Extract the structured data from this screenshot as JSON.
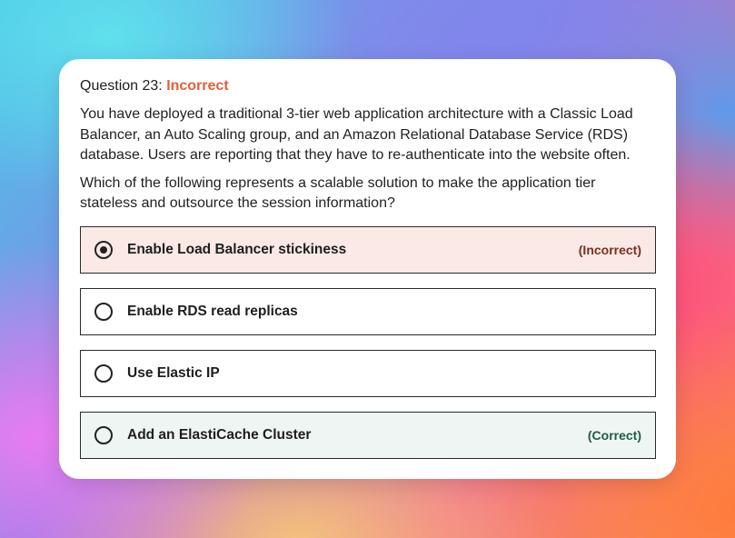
{
  "question": {
    "prefix": "Question 23:",
    "status": "Incorrect",
    "paragraphs": [
      "You have deployed a traditional 3-tier web application architecture with a Classic Load Balancer, an Auto Scaling group, and an Amazon Relational Database Service (RDS) database. Users are reporting that they have to re-authenticate into the website often.",
      "Which of the following represents a scalable solution to make the application tier stateless and outsource the session information?"
    ]
  },
  "options": [
    {
      "label": "Enable Load Balancer stickiness",
      "tag": "(Incorrect)",
      "selected": true
    },
    {
      "label": "Enable RDS read replicas",
      "tag": "",
      "selected": false
    },
    {
      "label": "Use Elastic IP",
      "tag": "",
      "selected": false
    },
    {
      "label": "Add an ElastiCache Cluster",
      "tag": "(Correct)",
      "selected": false
    }
  ],
  "colors": {
    "status_incorrect": "#e0603a",
    "incorrect_bg": "#fbe9e5",
    "correct_bg": "#eef5f3",
    "incorrect_tag": "#7a2e22",
    "correct_tag": "#1f5b4a"
  },
  "icons": {
    "radio_selected": "radio-selected-icon",
    "radio_unselected": "radio-unselected-icon"
  }
}
